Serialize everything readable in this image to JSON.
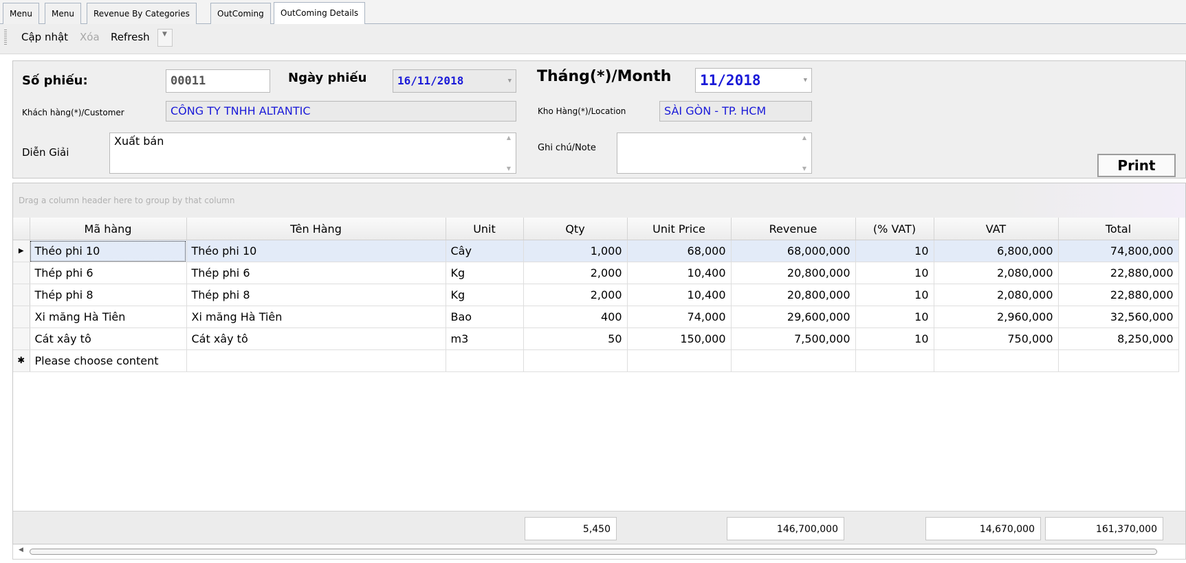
{
  "tabs": [
    {
      "label": "Menu"
    },
    {
      "label": "Menu"
    },
    {
      "label": "Revenue By Categories"
    },
    {
      "label": "OutComing"
    },
    {
      "label": "OutComing Details"
    }
  ],
  "toolbar": {
    "update_label": "Cập nhật",
    "delete_label": "Xóa",
    "refresh_label": "Refresh"
  },
  "form": {
    "so_phieu_label": "Số phiếu:",
    "so_phieu_value": "00011",
    "ngay_phieu_label": "Ngày phiếu",
    "ngay_phieu_value": "16/11/2018",
    "thang_label": "Tháng(*)/Month",
    "thang_value": "11/2018",
    "customer_label": "Khách hàng(*)/Customer",
    "customer_value": "CÔNG TY TNHH ALTANTIC",
    "location_label": "Kho Hàng(*)/Location",
    "location_value": "SÀI GÒN - TP. HCM",
    "dien_giai_label": "Diễn Giải",
    "dien_giai_value": "Xuất bán",
    "ghi_chu_label": "Ghi chú/Note",
    "ghi_chu_value": "",
    "print_label": "Print"
  },
  "grid": {
    "group_hint": "Drag a column header here to group by that column",
    "columns": [
      "Mã hàng",
      "Tên Hàng",
      "Unit",
      "Qty",
      "Unit Price",
      "Revenue",
      "(% VAT)",
      "VAT",
      "Total"
    ],
    "rows": [
      [
        "Théo phi 10",
        "Théo phi 10",
        "Cây",
        "1,000",
        "68,000",
        "68,000,000",
        "10",
        "6,800,000",
        "74,800,000"
      ],
      [
        "Thép phi 6",
        "Thép phi 6",
        "Kg",
        "2,000",
        "10,400",
        "20,800,000",
        "10",
        "2,080,000",
        "22,880,000"
      ],
      [
        "Thép phi 8",
        "Thép phi 8",
        "Kg",
        "2,000",
        "10,400",
        "20,800,000",
        "10",
        "2,080,000",
        "22,880,000"
      ],
      [
        "Xi măng Hà Tiên",
        "Xi măng Hà Tiên",
        "Bao",
        "400",
        "74,000",
        "29,600,000",
        "10",
        "2,960,000",
        "32,560,000"
      ],
      [
        "Cát xây tô",
        "Cát xây tô",
        "m3",
        "50",
        "150,000",
        "7,500,000",
        "10",
        "750,000",
        "8,250,000"
      ]
    ],
    "new_row_text": "Please choose content",
    "totals": {
      "qty": "5,450",
      "revenue": "146,700,000",
      "vat": "14,670,000",
      "total": "161,370,000"
    }
  }
}
